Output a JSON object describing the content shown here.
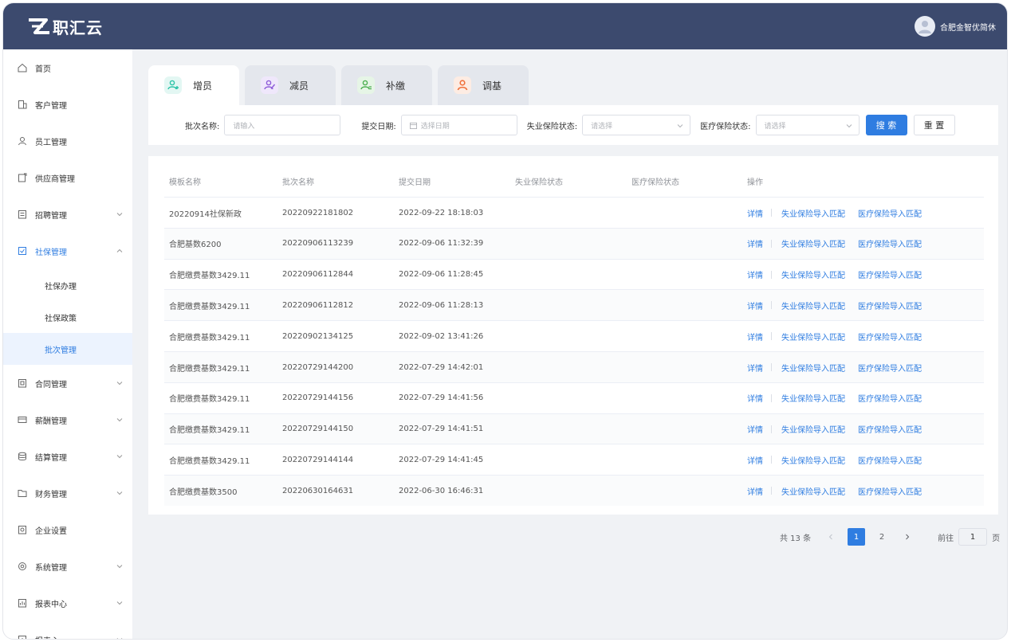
{
  "brand": {
    "name": "职汇云"
  },
  "user": {
    "name": "合肥金智优简休"
  },
  "sidebar": {
    "items": [
      {
        "label": "首页",
        "icon": "home-icon",
        "has_children": false
      },
      {
        "label": "客户管理",
        "icon": "building-icon",
        "has_children": false
      },
      {
        "label": "员工管理",
        "icon": "person-icon",
        "has_children": false
      },
      {
        "label": "供应商管理",
        "icon": "supplier-icon",
        "has_children": false
      },
      {
        "label": "招聘管理",
        "icon": "recruit-icon",
        "has_children": true
      },
      {
        "label": "社保管理",
        "icon": "insurance-icon",
        "has_children": true,
        "expanded": true,
        "children": [
          "社保办理",
          "社保政策",
          "批次管理"
        ],
        "active_child": 2
      },
      {
        "label": "合同管理",
        "icon": "contract-icon",
        "has_children": true
      },
      {
        "label": "薪酬管理",
        "icon": "salary-icon",
        "has_children": true
      },
      {
        "label": "结算管理",
        "icon": "database-icon",
        "has_children": true
      },
      {
        "label": "财务管理",
        "icon": "folder-icon",
        "has_children": true
      },
      {
        "label": "企业设置",
        "icon": "settings-doc-icon",
        "has_children": false
      },
      {
        "label": "系统管理",
        "icon": "gear-icon",
        "has_children": true
      },
      {
        "label": "报表中心",
        "icon": "report-icon",
        "has_children": true
      },
      {
        "label": "报表心",
        "icon": "report-icon",
        "has_children": true
      }
    ]
  },
  "tabs": [
    {
      "label": "增员",
      "icon": "add-person-icon",
      "color": "#2cc4a8",
      "bg": "#e3f7f3"
    },
    {
      "label": "减员",
      "icon": "remove-person-icon",
      "color": "#8e5bd9",
      "bg": "#efe7fb"
    },
    {
      "label": "补缴",
      "icon": "supplement-icon",
      "color": "#4caf50",
      "bg": "#e6f5e6"
    },
    {
      "label": "调基",
      "icon": "adjust-icon",
      "color": "#f0703a",
      "bg": "#fdece3"
    }
  ],
  "filters": {
    "batch_name_label": "批次名称:",
    "batch_name_placeholder": "请输入",
    "submit_date_label": "提交日期:",
    "submit_date_placeholder": "选择日期",
    "unemployment_label": "失业保险状态:",
    "unemployment_placeholder": "请选择",
    "medical_label": "医疗保险状态:",
    "medical_placeholder": "请选择",
    "search_btn": "搜 索",
    "reset_btn": "重 置"
  },
  "table": {
    "headers": [
      "模板名称",
      "批次名称",
      "提交日期",
      "失业保险状态",
      "医疗保险状态",
      "操作"
    ],
    "action_labels": [
      "详情",
      "失业保险导入匹配",
      "医疗保险导入匹配"
    ],
    "rows": [
      [
        "20220914社保新政",
        "20220922181802",
        "2022-09-22 18:18:03"
      ],
      [
        "合肥基数6200",
        "20220906113239",
        "2022-09-06 11:32:39"
      ],
      [
        "合肥缴费基数3429.11",
        "20220906112844",
        "2022-09-06 11:28:45"
      ],
      [
        "合肥缴费基数3429.11",
        "20220906112812",
        "2022-09-06 11:28:13"
      ],
      [
        "合肥缴费基数3429.11",
        "20220902134125",
        "2022-09-02 13:41:26"
      ],
      [
        "合肥缴费基数3429.11",
        "20220729144200",
        "2022-07-29 14:42:01"
      ],
      [
        "合肥缴费基数3429.11",
        "20220729144156",
        "2022-07-29 14:41:56"
      ],
      [
        "合肥缴费基数3429.11",
        "20220729144150",
        "2022-07-29 14:41:51"
      ],
      [
        "合肥缴费基数3429.11",
        "20220729144144",
        "2022-07-29 14:41:45"
      ],
      [
        "合肥缴费基数3500",
        "20220630164631",
        "2022-06-30 16:46:31"
      ]
    ]
  },
  "pagination": {
    "total_text": "共 13 条",
    "pages": [
      "1",
      "2"
    ],
    "current": "1",
    "goto_label": "前往",
    "goto_value": "1",
    "page_suffix": "页"
  },
  "colors": {
    "topbar": "#3c4a6e",
    "primary": "#2f7de1"
  }
}
